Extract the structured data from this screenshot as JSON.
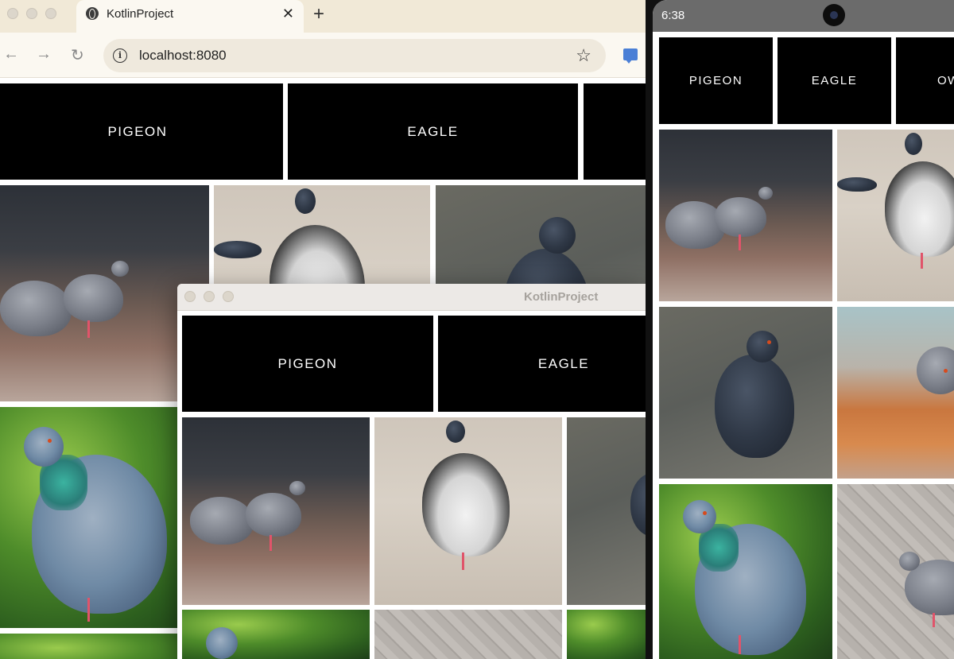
{
  "browser": {
    "tab_title": "KotlinProject",
    "tab_close": "✕",
    "new_tab": "+",
    "back": "←",
    "forward": "→",
    "reload": "↻",
    "url": "localhost:8080",
    "info": "i",
    "star": "☆",
    "categories": [
      "PIGEON",
      "EAGLE"
    ]
  },
  "desktop_app": {
    "title": "KotlinProject",
    "categories": [
      "PIGEON",
      "EAGLE"
    ]
  },
  "phone": {
    "time": "6:38",
    "categories": [
      "PIGEON",
      "EAGLE",
      "OW"
    ]
  },
  "icons": {
    "site_info": "info-icon",
    "bookmark": "star-icon",
    "tab_favicon": "globe-icon",
    "extension": "chat-icon"
  }
}
